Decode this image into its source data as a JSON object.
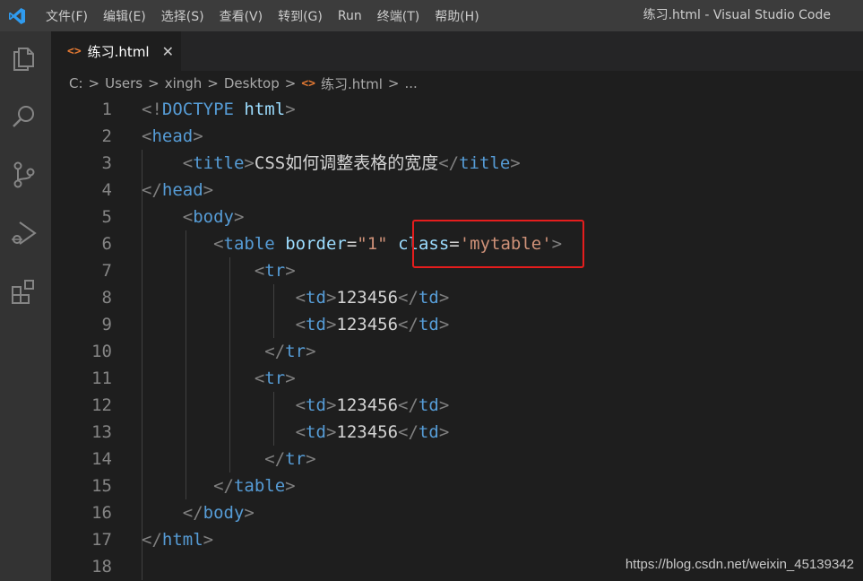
{
  "titlebar": {
    "menu": [
      "文件(F)",
      "编辑(E)",
      "选择(S)",
      "查看(V)",
      "转到(G)",
      "Run",
      "终端(T)",
      "帮助(H)"
    ],
    "window_title": "练习.html - Visual Studio Code"
  },
  "activity_bar": {
    "icons": [
      "explorer-icon",
      "search-icon",
      "source-control-icon",
      "run-debug-icon",
      "extensions-icon"
    ]
  },
  "tab": {
    "label": "练习.html",
    "icon": "<>",
    "close": "✕"
  },
  "breadcrumb": {
    "items": [
      "C:",
      "Users",
      "xingh",
      "Desktop",
      "练习.html",
      "..."
    ],
    "separator": ">",
    "file_icon": "<>"
  },
  "editor": {
    "lines": [
      {
        "num": "1",
        "tokens": [
          [
            "pu",
            "<!"
          ],
          [
            "tg",
            "DOCTYPE"
          ],
          [
            "tx",
            " "
          ],
          [
            "at",
            "html"
          ],
          [
            "pu",
            ">"
          ]
        ]
      },
      {
        "num": "2",
        "tokens": [
          [
            "pu",
            "<"
          ],
          [
            "tg",
            "head"
          ],
          [
            "pu",
            ">"
          ]
        ]
      },
      {
        "num": "3",
        "indent": "    ",
        "tokens": [
          [
            "pu",
            "<"
          ],
          [
            "tg",
            "title"
          ],
          [
            "pu",
            ">"
          ],
          [
            "tx",
            "CSS如何调整表格的宽度"
          ],
          [
            "pu",
            "</"
          ],
          [
            "tg",
            "title"
          ],
          [
            "pu",
            ">"
          ]
        ]
      },
      {
        "num": "4",
        "tokens": [
          [
            "pu",
            "</"
          ],
          [
            "tg",
            "head"
          ],
          [
            "pu",
            ">"
          ]
        ]
      },
      {
        "num": "5",
        "indent": "    ",
        "tokens": [
          [
            "pu",
            "<"
          ],
          [
            "tg",
            "body"
          ],
          [
            "pu",
            ">"
          ]
        ]
      },
      {
        "num": "6",
        "indent": "       ",
        "tokens": [
          [
            "pu",
            "<"
          ],
          [
            "tg",
            "table"
          ],
          [
            "tx",
            " "
          ],
          [
            "at",
            "border"
          ],
          [
            "tx",
            "="
          ],
          [
            "st",
            "\"1\""
          ],
          [
            "tx",
            " "
          ],
          [
            "at",
            "class"
          ],
          [
            "tx",
            "="
          ],
          [
            "st",
            "'mytable'"
          ],
          [
            "pu",
            ">"
          ]
        ]
      },
      {
        "num": "7",
        "indent": "           ",
        "tokens": [
          [
            "pu",
            "<"
          ],
          [
            "tg",
            "tr"
          ],
          [
            "pu",
            ">"
          ]
        ]
      },
      {
        "num": "8",
        "indent": "               ",
        "tokens": [
          [
            "pu",
            "<"
          ],
          [
            "tg",
            "td"
          ],
          [
            "pu",
            ">"
          ],
          [
            "tx",
            "123456"
          ],
          [
            "pu",
            "</"
          ],
          [
            "tg",
            "td"
          ],
          [
            "pu",
            ">"
          ]
        ]
      },
      {
        "num": "9",
        "indent": "               ",
        "tokens": [
          [
            "pu",
            "<"
          ],
          [
            "tg",
            "td"
          ],
          [
            "pu",
            ">"
          ],
          [
            "tx",
            "123456"
          ],
          [
            "pu",
            "</"
          ],
          [
            "tg",
            "td"
          ],
          [
            "pu",
            ">"
          ]
        ]
      },
      {
        "num": "10",
        "indent": "            ",
        "tokens": [
          [
            "pu",
            "</"
          ],
          [
            "tg",
            "tr"
          ],
          [
            "pu",
            ">"
          ]
        ]
      },
      {
        "num": "11",
        "indent": "           ",
        "tokens": [
          [
            "pu",
            "<"
          ],
          [
            "tg",
            "tr"
          ],
          [
            "pu",
            ">"
          ]
        ]
      },
      {
        "num": "12",
        "indent": "               ",
        "tokens": [
          [
            "pu",
            "<"
          ],
          [
            "tg",
            "td"
          ],
          [
            "pu",
            ">"
          ],
          [
            "tx",
            "123456"
          ],
          [
            "pu",
            "</"
          ],
          [
            "tg",
            "td"
          ],
          [
            "pu",
            ">"
          ]
        ]
      },
      {
        "num": "13",
        "indent": "               ",
        "tokens": [
          [
            "pu",
            "<"
          ],
          [
            "tg",
            "td"
          ],
          [
            "pu",
            ">"
          ],
          [
            "tx",
            "123456"
          ],
          [
            "pu",
            "</"
          ],
          [
            "tg",
            "td"
          ],
          [
            "pu",
            ">"
          ]
        ]
      },
      {
        "num": "14",
        "indent": "            ",
        "tokens": [
          [
            "pu",
            "</"
          ],
          [
            "tg",
            "tr"
          ],
          [
            "pu",
            ">"
          ]
        ]
      },
      {
        "num": "15",
        "indent": "       ",
        "tokens": [
          [
            "pu",
            "</"
          ],
          [
            "tg",
            "table"
          ],
          [
            "pu",
            ">"
          ]
        ]
      },
      {
        "num": "16",
        "indent": "    ",
        "tokens": [
          [
            "pu",
            "</"
          ],
          [
            "tg",
            "body"
          ],
          [
            "pu",
            ">"
          ]
        ]
      },
      {
        "num": "17",
        "tokens": [
          [
            "pu",
            "</"
          ],
          [
            "tg",
            "html"
          ],
          [
            "pu",
            ">"
          ]
        ]
      },
      {
        "num": "18",
        "tokens": []
      }
    ]
  },
  "watermark": "https://blog.csdn.net/weixin_45139342",
  "colors": {
    "tag": "#569cd6",
    "attribute": "#9cdcfe",
    "string": "#ce9178",
    "punctuation": "#808080",
    "highlight_box": "#e51d1d",
    "html_icon": "#e37933"
  }
}
